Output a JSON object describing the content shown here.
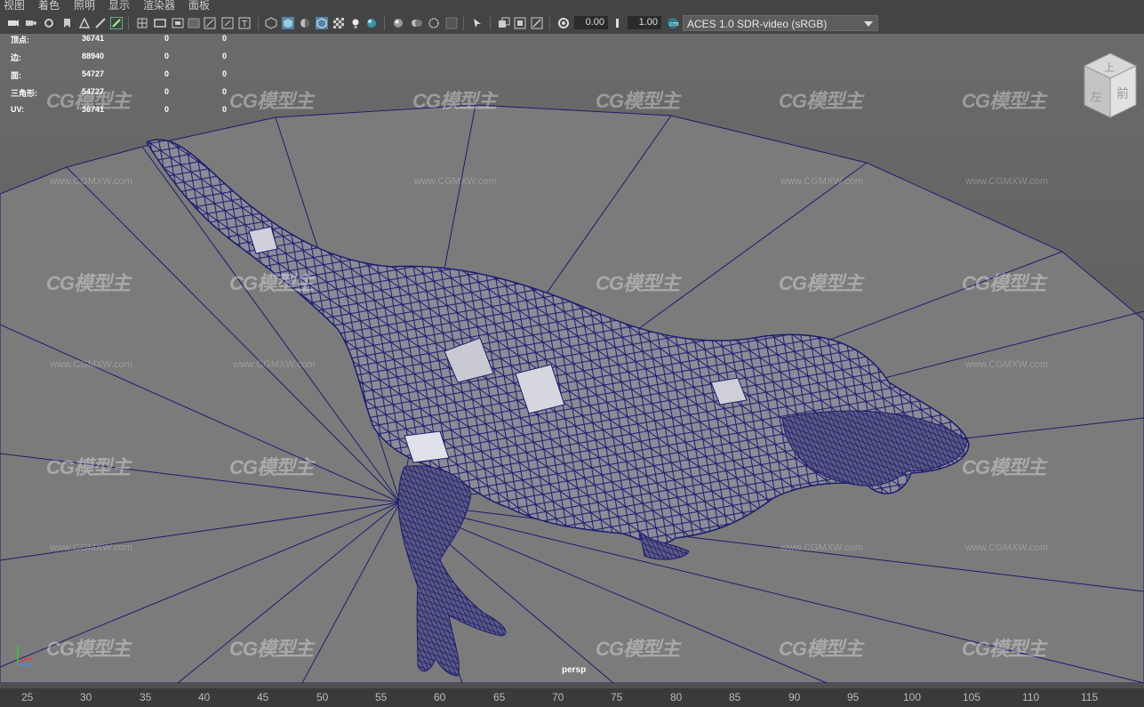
{
  "menu": {
    "items": [
      "视图",
      "着色",
      "照明",
      "显示",
      "渲染器",
      "面板"
    ]
  },
  "toolbar": {
    "exposure_value": "0.00",
    "gamma_value": "1.00",
    "color_space": "ACES 1.0 SDR-video (sRGB)"
  },
  "hud": {
    "rows": [
      {
        "label": "顶点:",
        "v1": "36741",
        "v2": "0",
        "v3": "0"
      },
      {
        "label": "边:",
        "v1": "88940",
        "v2": "0",
        "v3": "0"
      },
      {
        "label": "面:",
        "v1": "54727",
        "v2": "0",
        "v3": "0"
      },
      {
        "label": "三角形:",
        "v1": "54727",
        "v2": "0",
        "v3": "0"
      },
      {
        "label": "UV:",
        "v1": "36741",
        "v2": "0",
        "v3": "0"
      }
    ]
  },
  "viewport": {
    "camera_label": "persp",
    "wireframe_color": "#1c1c6e",
    "background_color": "#6a6a6a"
  },
  "viewcube": {
    "top_label": "上",
    "left_label": "左",
    "front_label": "前"
  },
  "watermark": {
    "logo": "CG模型主",
    "url": "www.CGMXW.com"
  },
  "timeline": {
    "ticks": [
      "25",
      "30",
      "35",
      "40",
      "45",
      "50",
      "55",
      "60",
      "65",
      "70",
      "75",
      "80",
      "85",
      "90",
      "95",
      "100",
      "105",
      "110",
      "115"
    ]
  },
  "colors": {
    "accent": "#5285a6",
    "ui_bg": "#444444",
    "wire": "#1c1c6e"
  }
}
